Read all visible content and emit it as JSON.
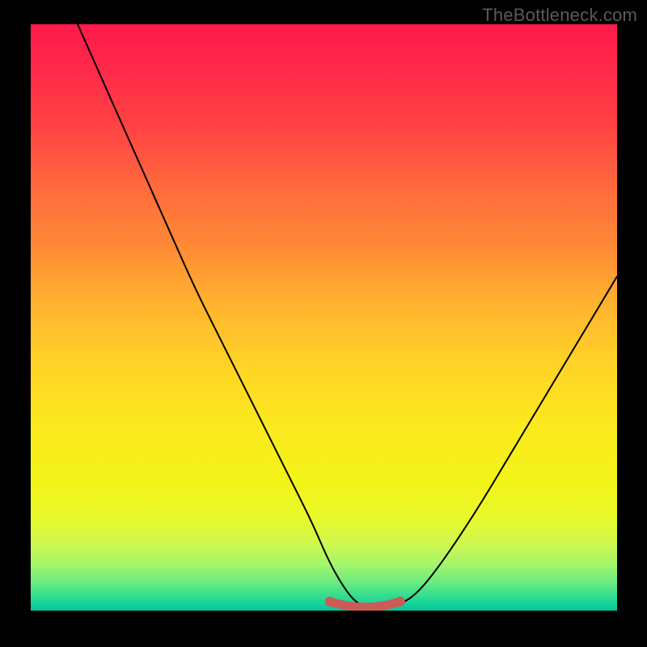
{
  "attribution": "TheBottleneck.com",
  "chart_data": {
    "type": "line",
    "title": "",
    "xlabel": "",
    "ylabel": "",
    "xlim": [
      0,
      100
    ],
    "ylim": [
      0,
      100
    ],
    "x": [
      8,
      12,
      16,
      20,
      24,
      28,
      32,
      36,
      40,
      44,
      48,
      51,
      54,
      56,
      58,
      60,
      63,
      66,
      70,
      76,
      82,
      88,
      94,
      100
    ],
    "values": [
      100,
      91,
      82,
      73,
      64,
      55,
      47,
      39,
      31,
      23,
      15,
      8,
      3,
      1,
      0.5,
      0.5,
      1,
      3,
      8,
      17,
      27,
      37,
      47,
      57
    ],
    "highlight_segment": {
      "x_start": 51,
      "x_end": 63,
      "y": 1
    },
    "gradient_stops": [
      {
        "pos": 0,
        "color": "#ff1a4a"
      },
      {
        "pos": 18,
        "color": "#ff4542"
      },
      {
        "pos": 38,
        "color": "#ff8a35"
      },
      {
        "pos": 58,
        "color": "#ffd326"
      },
      {
        "pos": 78,
        "color": "#f3f418"
      },
      {
        "pos": 92,
        "color": "#a5f56a"
      },
      {
        "pos": 100,
        "color": "#06c69c"
      }
    ]
  }
}
